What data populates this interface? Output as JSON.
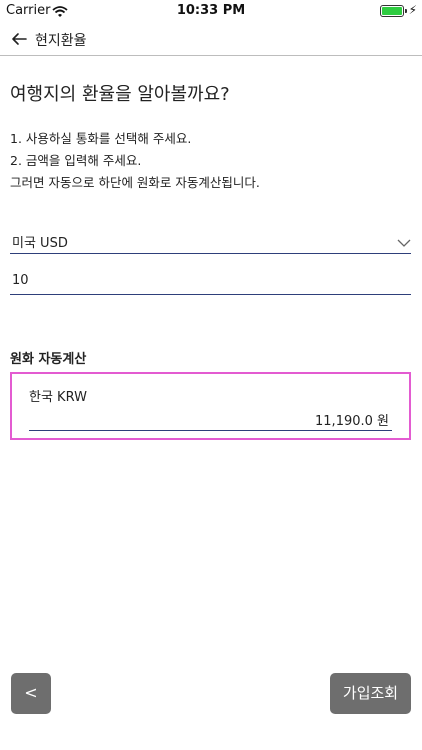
{
  "status_bar": {
    "carrier": "Carrier",
    "time": "10:33 PM",
    "battery_level": 1.0
  },
  "nav": {
    "title": "현지환율"
  },
  "headline": "여행지의 환율을 알아볼까요?",
  "instructions": [
    "1. 사용하실 통화를 선택해 주세요.",
    "2. 금액을 입력해 주세요.",
    "그러면 자동으로 하단에 원화로 자동계산됩니다."
  ],
  "currency_select": {
    "selected": "미국 USD"
  },
  "amount_input": {
    "value": "10"
  },
  "result": {
    "label": "원화 자동계산",
    "currency": "한국 KRW",
    "amount": "11,190.0 원"
  },
  "buttons": {
    "prev_label": "<",
    "join_label": "가입조회"
  },
  "colors": {
    "highlight_border": "#e35bd1",
    "underline": "#2e3f7a",
    "button_bg": "#6e6e6e",
    "battery": "#2ecc40"
  }
}
